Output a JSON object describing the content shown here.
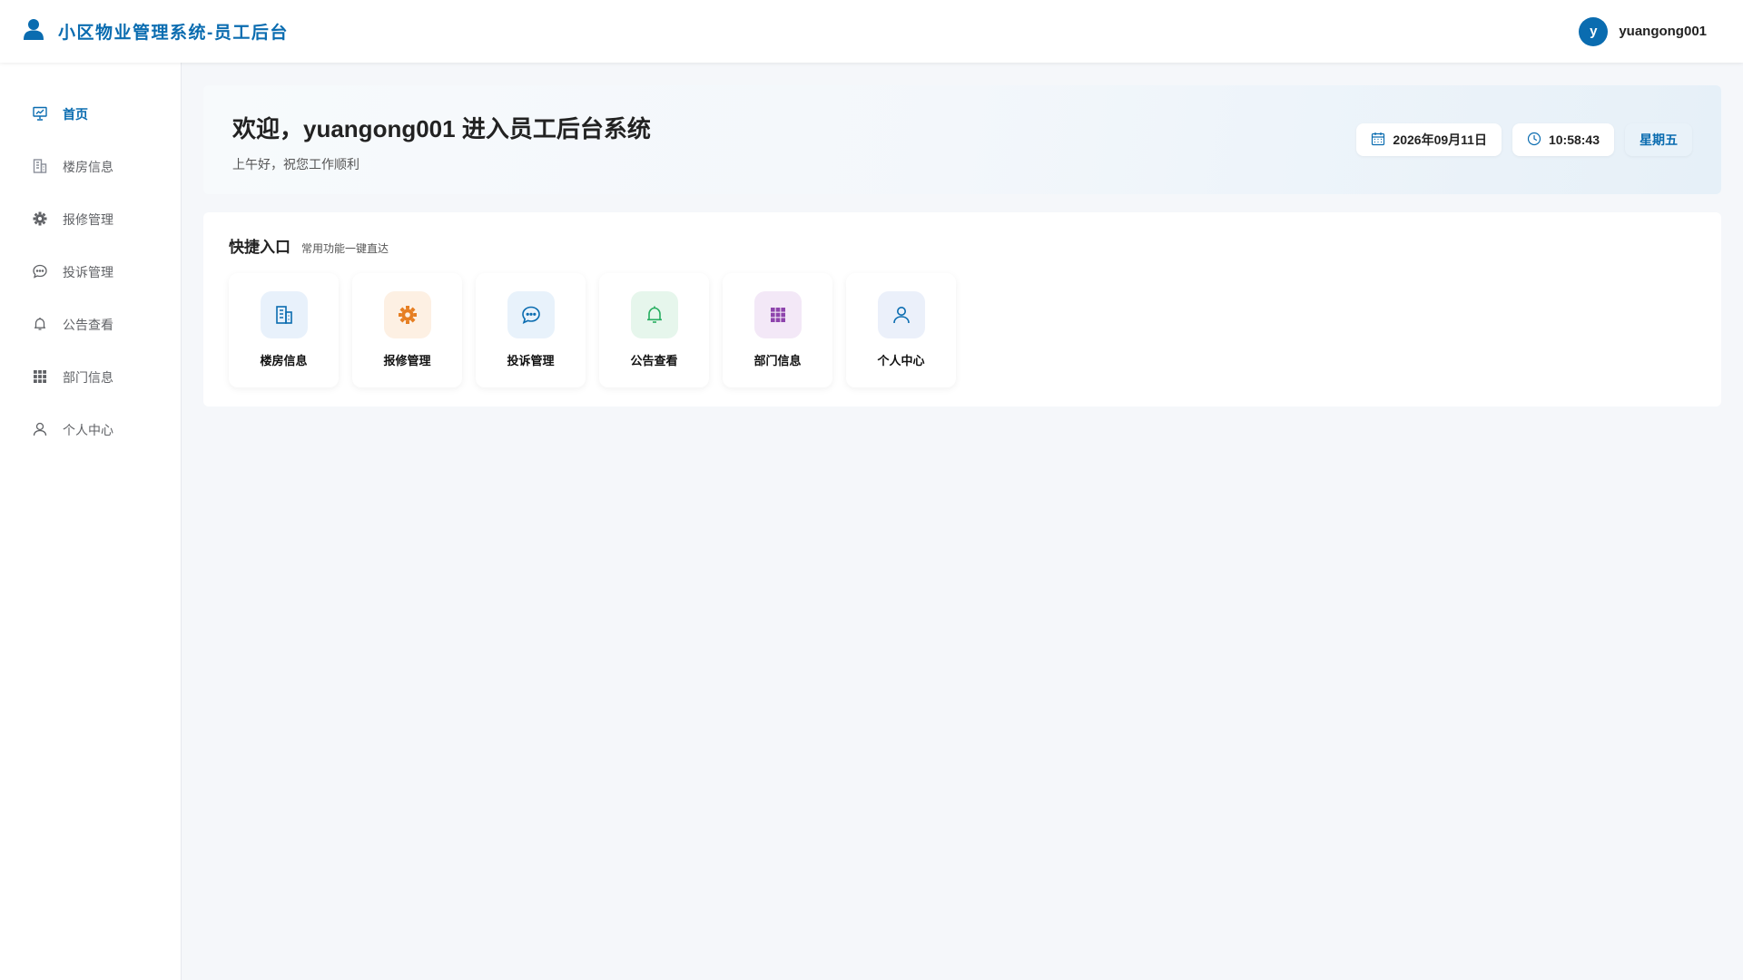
{
  "header": {
    "title": "小区物业管理系统-员工后台",
    "brand_icon": "user-icon",
    "avatar_letter": "y",
    "username": "yuangong001",
    "accent": "#0a6cb0"
  },
  "sidebar": {
    "items": [
      {
        "label": "首页",
        "icon": "dashboard-icon",
        "active": true
      },
      {
        "label": "楼房信息",
        "icon": "building-icon"
      },
      {
        "label": "报修管理",
        "icon": "gear-icon"
      },
      {
        "label": "投诉管理",
        "icon": "chat-icon"
      },
      {
        "label": "公告查看",
        "icon": "bell-icon"
      },
      {
        "label": "部门信息",
        "icon": "grid-icon"
      },
      {
        "label": "个人中心",
        "icon": "user-icon"
      }
    ]
  },
  "welcome": {
    "title": "欢迎，yuangong001 进入员工后台系统",
    "subtitle": "上午好，祝您工作顺利",
    "date": "2026年09月11日",
    "time": "10:58:43",
    "weekday": "星期五"
  },
  "quick": {
    "title": "快捷入口",
    "subtitle": "常用功能一键直达",
    "items": [
      {
        "label": "楼房信息",
        "icon": "building-icon",
        "bg": "#e8f1fb",
        "color": "#0a6cb0"
      },
      {
        "label": "报修管理",
        "icon": "gear-icon",
        "bg": "#fdf0e3",
        "color": "#e67e22"
      },
      {
        "label": "投诉管理",
        "icon": "chat-icon",
        "bg": "#e8f2fb",
        "color": "#0a6cb0"
      },
      {
        "label": "公告查看",
        "icon": "bell-icon",
        "bg": "#e6f6ec",
        "color": "#27ae60"
      },
      {
        "label": "部门信息",
        "icon": "grid-icon",
        "bg": "#f3e8f7",
        "color": "#8e44ad"
      },
      {
        "label": "个人中心",
        "icon": "user-icon",
        "bg": "#ebf0fa",
        "color": "#0a6cb0"
      }
    ]
  }
}
